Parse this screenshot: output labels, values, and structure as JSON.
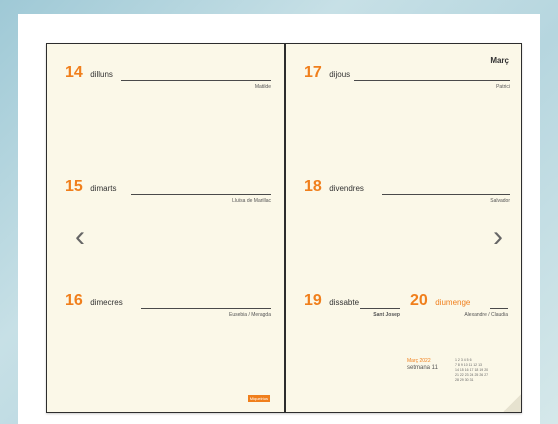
{
  "left_page": {
    "days": [
      {
        "num": "14",
        "name": "dilluns",
        "saint": "Matilde"
      },
      {
        "num": "15",
        "name": "dimarts",
        "saint": "Lluïsa de Marillac"
      },
      {
        "num": "16",
        "name": "dimecres",
        "saint": "Eusebia / Meragda"
      }
    ],
    "brand": "Miquelrius"
  },
  "right_page": {
    "month": "Març",
    "days": [
      {
        "num": "17",
        "name": "dijous",
        "saint": "Patrici"
      },
      {
        "num": "18",
        "name": "divendres",
        "saint": "Salvador"
      },
      {
        "num": "19",
        "name": "dissabte",
        "saint": "Sant Josep"
      },
      {
        "num": "20",
        "name": "diumenge",
        "saint": "Alexandre / Claudia"
      }
    ],
    "mini_calendar": {
      "label": "Març 2022",
      "week": "setmana 11",
      "rows": [
        "1 2 3 4 5 6",
        "7 8 9 10 11 12 13",
        "14 15 16 17 18 19 20",
        "21 22 23 24 25 26 27",
        "28 29 30 31"
      ]
    }
  },
  "nav": {
    "prev": "‹",
    "next": "›"
  }
}
